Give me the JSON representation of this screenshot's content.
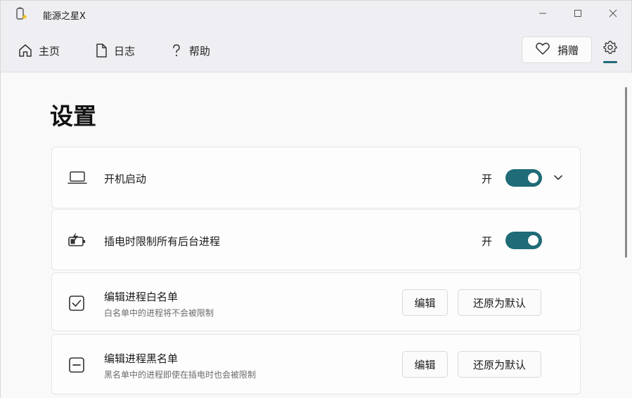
{
  "app": {
    "title": "能源之星X",
    "app_icon": "battery-star-icon"
  },
  "window_controls": {
    "minimize_icon": "minimize-icon",
    "maximize_icon": "maximize-icon",
    "close_icon": "close-icon"
  },
  "nav": {
    "items": [
      {
        "label": "主页",
        "icon": "home-icon"
      },
      {
        "label": "日志",
        "icon": "document-icon"
      },
      {
        "label": "帮助",
        "icon": "question-icon"
      }
    ],
    "donate_label": "捐赠",
    "donate_icon": "heart-icon",
    "settings_icon": "gear-icon"
  },
  "page": {
    "title": "设置"
  },
  "settings": {
    "autostart": {
      "label": "开机启动",
      "toggle_text": "开",
      "enabled": true,
      "icon": "laptop-icon"
    },
    "restrict_background": {
      "label": "插电时限制所有后台进程",
      "toggle_text": "开",
      "enabled": true,
      "icon": "battery-charging-icon"
    },
    "whitelist": {
      "label": "编辑进程白名单",
      "subtitle": "白名单中的进程将不会被限制",
      "edit_label": "编辑",
      "reset_label": "还原为默认",
      "icon": "checkbox-checked-icon"
    },
    "blacklist": {
      "label": "编辑进程黑名单",
      "subtitle": "黑名单中的进程即使在插电时也会被限制",
      "edit_label": "编辑",
      "reset_label": "还原为默认",
      "icon": "checkbox-minus-icon"
    }
  },
  "colors": {
    "accent": "#1f6b77"
  }
}
